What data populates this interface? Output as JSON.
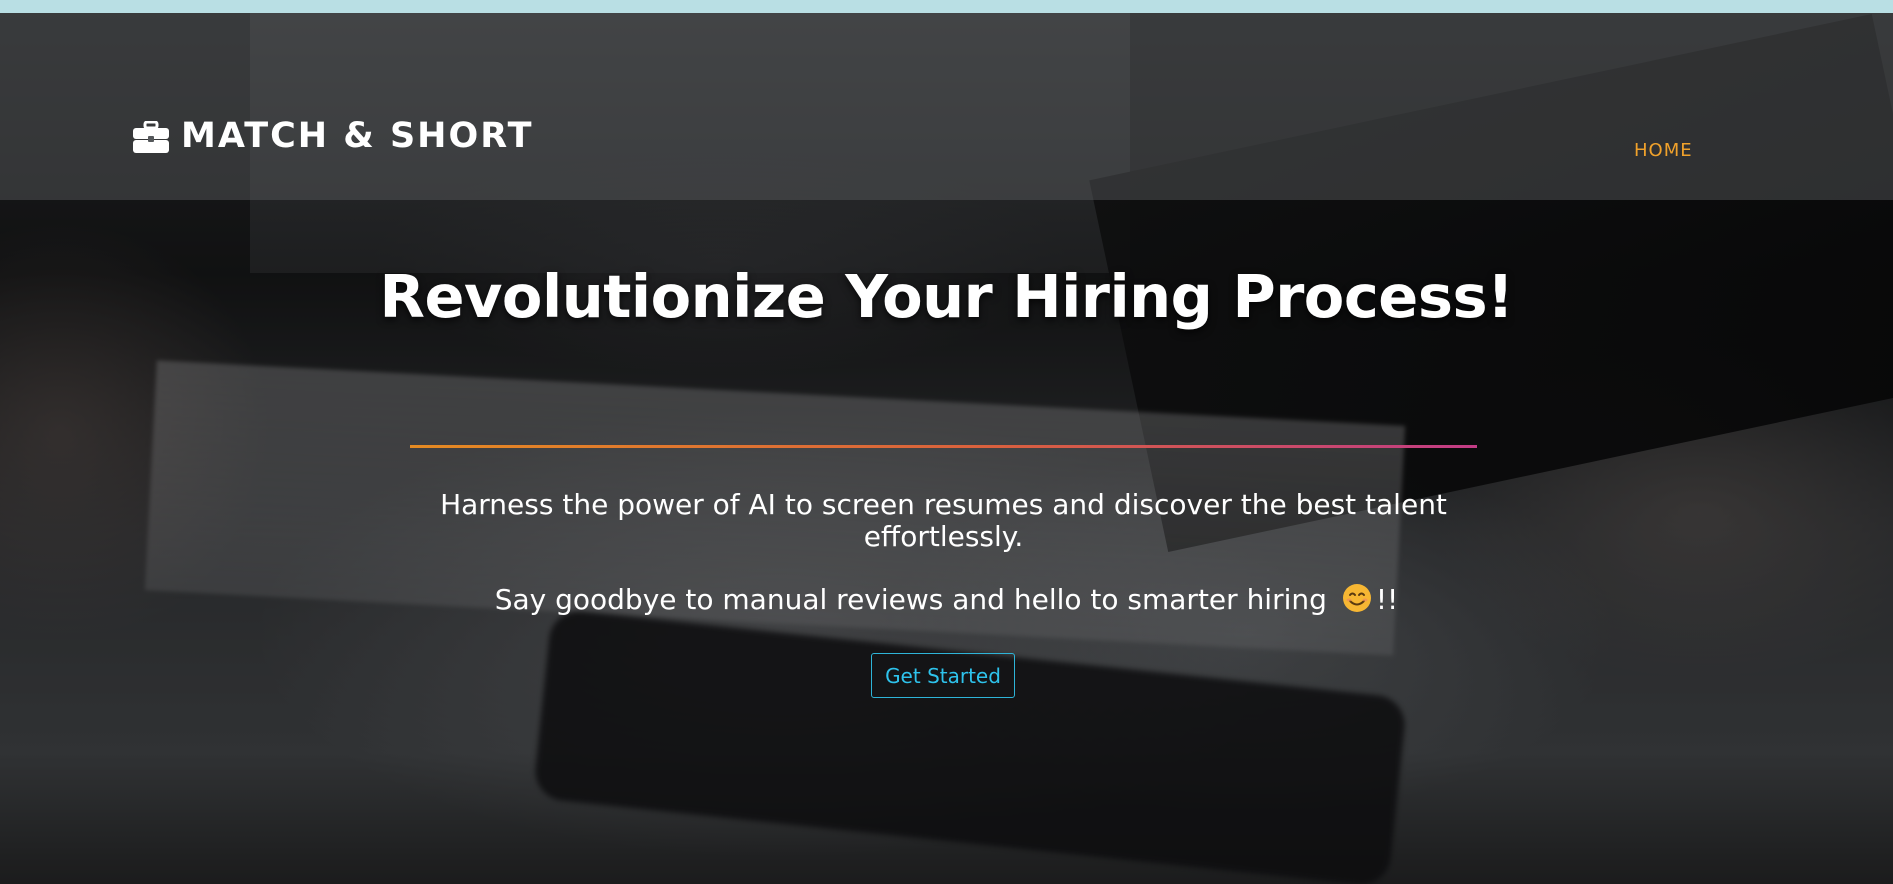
{
  "header": {
    "brand_name": "MATCH & SHORT",
    "brand_icon": "briefcase-icon",
    "nav": {
      "home_label": "HOME"
    }
  },
  "hero": {
    "title": "Revolutionize Your Hiring Process!",
    "subtitle": "Harness the power of AI to screen resumes and discover the best talent effortlessly.",
    "tagline_text": "Say goodbye to manual reviews and hello to smarter hiring",
    "tagline_emoji": "smiling-face-icon",
    "tagline_suffix": "!!",
    "cta_label": "Get Started"
  },
  "colors": {
    "top_strip": "#b9dfe4",
    "nav_accent": "#f0a12b",
    "cta_accent": "#2ec3ec",
    "divider_start": "#e58a22",
    "divider_end": "#c23c86"
  }
}
